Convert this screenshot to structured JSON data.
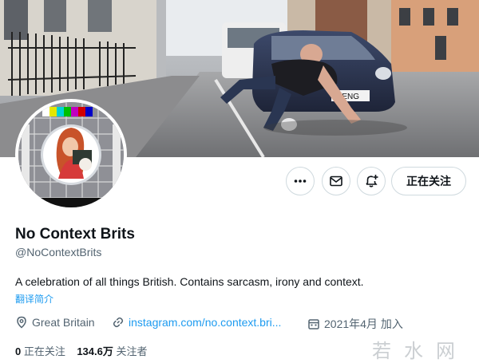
{
  "profile": {
    "name": "No Context Brits",
    "handle": "@NoContextBrits",
    "bio": "A celebration of all things British. Contains sarcasm, irony and context.",
    "translate_label": "翻译简介",
    "location": "Great Britain",
    "website": "instagram.com/no.context.bri...",
    "joined": "2021年4月 加入"
  },
  "stats": {
    "following_count": "0",
    "following_label": "正在关注",
    "followers_count": "134.6万",
    "followers_label": "关注者"
  },
  "actions": {
    "follow_label": "正在关注",
    "more_icon": "more-icon",
    "message_icon": "mail-icon",
    "notify_icon": "bell-plus-icon"
  },
  "banner": {
    "plate_text": "7 ENG"
  },
  "watermark": "若水网",
  "colors": {
    "link": "#1d9bf0",
    "text": "#0f1419",
    "secondary": "#536471",
    "border": "#cfd9de"
  }
}
